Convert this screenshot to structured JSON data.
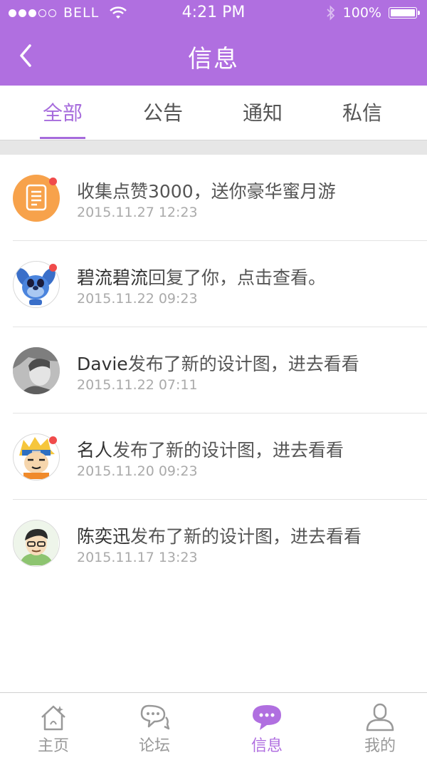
{
  "status_bar": {
    "carrier": "BELL",
    "time": "4:21 PM",
    "battery": "100%"
  },
  "nav": {
    "title": "信息"
  },
  "tabs": [
    {
      "label": "全部",
      "active": true
    },
    {
      "label": "公告",
      "active": false
    },
    {
      "label": "通知",
      "active": false
    },
    {
      "label": "私信",
      "active": false
    }
  ],
  "messages": [
    {
      "name": "",
      "text": "收集点赞3000，送你豪华蜜月游",
      "date": "2015.11.27 12:23",
      "unread": true,
      "avatar": "document-icon"
    },
    {
      "name": "碧流碧流",
      "text": "回复了你，点击查看。",
      "date": "2015.11.22 09:23",
      "unread": true,
      "avatar": "stitch-avatar"
    },
    {
      "name": "Davie",
      "text": "发布了新的设计图，进去看看",
      "date": "2015.11.22 07:11",
      "unread": false,
      "avatar": "photo-avatar"
    },
    {
      "name": "名人",
      "text": "发布了新的设计图，进去看看",
      "date": "2015.11.20 09:23",
      "unread": true,
      "avatar": "cartoon-avatar"
    },
    {
      "name": "陈奕迅",
      "text": "发布了新的设计图，进去看看",
      "date": "2015.11.17 13:23",
      "unread": false,
      "avatar": "cartoon-man-avatar"
    }
  ],
  "tabbar": [
    {
      "label": "主页",
      "icon": "home-icon",
      "active": false
    },
    {
      "label": "论坛",
      "icon": "chat-bubbles-icon",
      "active": false
    },
    {
      "label": "信息",
      "icon": "message-icon",
      "active": true
    },
    {
      "label": "我的",
      "icon": "user-icon",
      "active": false
    }
  ],
  "colors": {
    "brand": "#b06fe0",
    "badge": "#f04b4b",
    "avatar_orange": "#f7a24b"
  }
}
